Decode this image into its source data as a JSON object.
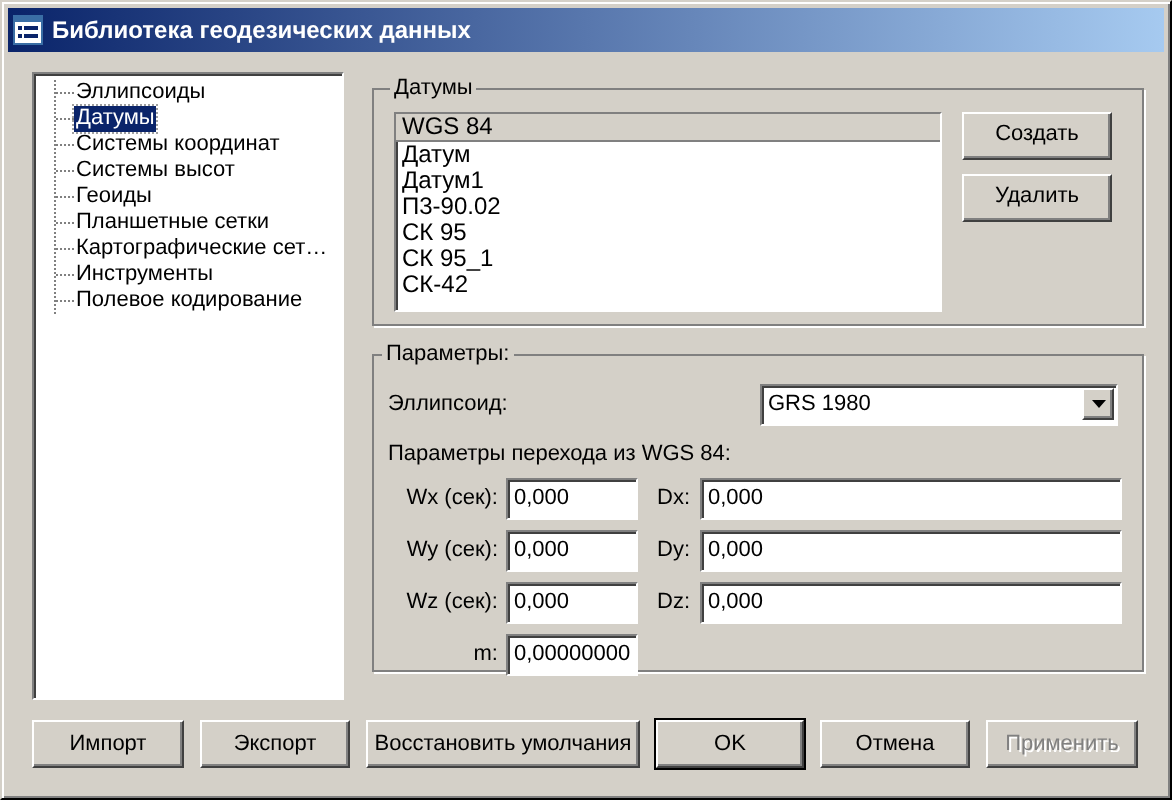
{
  "window": {
    "title": "Библиотека геодезических данных"
  },
  "tree": {
    "items": [
      {
        "label": "Эллипсоиды",
        "selected": false
      },
      {
        "label": "Датумы",
        "selected": true
      },
      {
        "label": "Системы координат",
        "selected": false
      },
      {
        "label": "Системы высот",
        "selected": false
      },
      {
        "label": "Геоиды",
        "selected": false
      },
      {
        "label": "Планшетные сетки",
        "selected": false
      },
      {
        "label": "Картографические сет…",
        "selected": false
      },
      {
        "label": "Инструменты",
        "selected": false
      },
      {
        "label": "Полевое кодирование",
        "selected": false
      }
    ]
  },
  "datums": {
    "title": "Датумы",
    "items": [
      {
        "label": "WGS 84",
        "selected": true
      },
      {
        "label": "Датум",
        "selected": false
      },
      {
        "label": "Датум1",
        "selected": false
      },
      {
        "label": "П3-90.02",
        "selected": false
      },
      {
        "label": "СК 95",
        "selected": false
      },
      {
        "label": "СК 95_1",
        "selected": false
      },
      {
        "label": "СК-42",
        "selected": false
      }
    ],
    "buttons": [
      "Создать",
      "Удалить"
    ]
  },
  "parameters": {
    "title": "Параметры:",
    "ellipsoid": {
      "label": "Эллипсоид:",
      "value": "GRS 1980"
    },
    "transition_label": "Параметры перехода из WGS 84:",
    "rows": [
      {
        "left": {
          "label": "Wx (сек):",
          "value": "0,000"
        },
        "right": {
          "label": "Dx:",
          "value": "0,000"
        }
      },
      {
        "left": {
          "label": "Wy (сек):",
          "value": "0,000"
        },
        "right": {
          "label": "Dy:",
          "value": "0,000"
        }
      },
      {
        "left": {
          "label": "Wz (сек):",
          "value": "0,000"
        },
        "right": {
          "label": "Dz:",
          "value": "0,000"
        }
      },
      {
        "left": {
          "label": "m:",
          "value": "0,00000000"
        }
      }
    ]
  },
  "buttons": [
    {
      "label": "Импорт",
      "default": false,
      "disabled": false
    },
    {
      "label": "Экспорт",
      "default": false,
      "disabled": false
    },
    {
      "label": "Восстановить умолчания",
      "default": false,
      "disabled": false
    },
    {
      "label": "OK",
      "default": true,
      "disabled": false
    },
    {
      "label": "Отмена",
      "default": false,
      "disabled": false
    },
    {
      "label": "Применить",
      "default": false,
      "disabled": true
    }
  ]
}
